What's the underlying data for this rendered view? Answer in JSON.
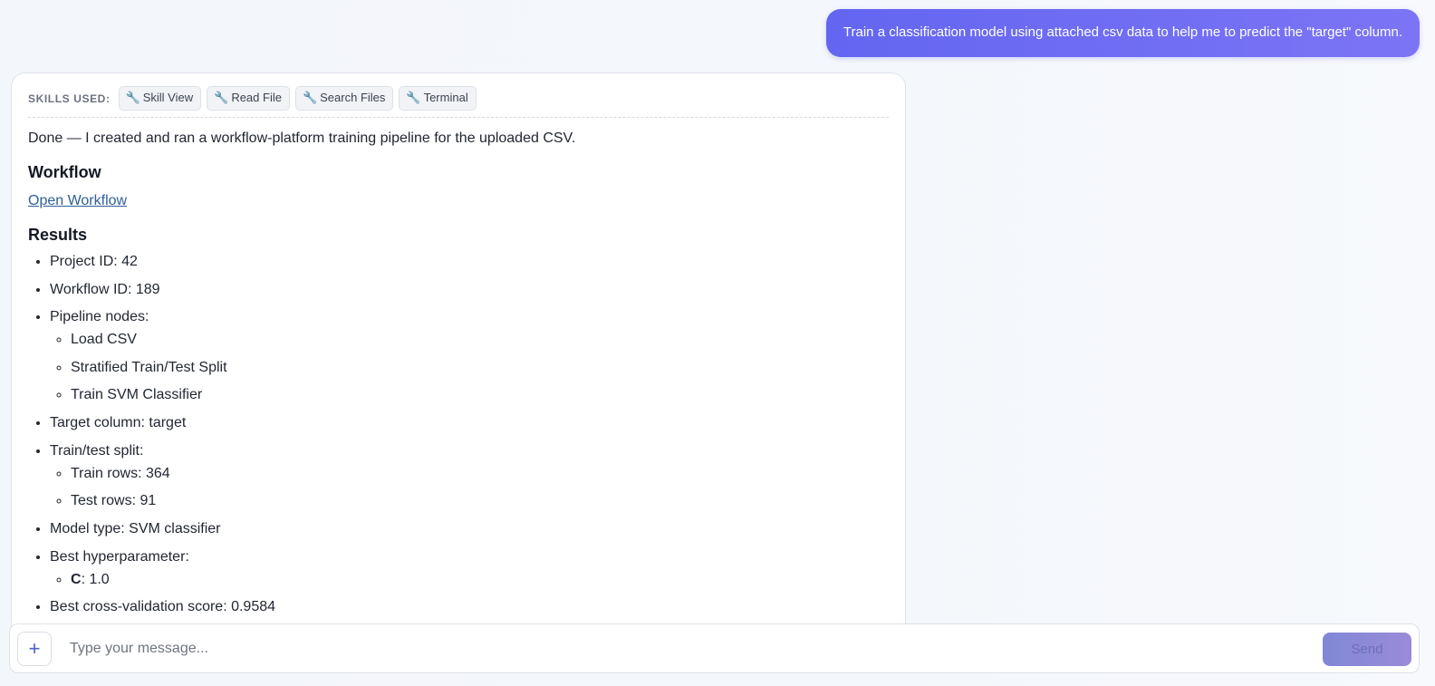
{
  "user_message": {
    "text": "Train a classification model using attached csv data to help me to predict the \"target\" column."
  },
  "assistant": {
    "skills_label": "SKILLS USED:",
    "skills": [
      {
        "icon": "wrench-icon",
        "glyph": "🔧",
        "label": "Skill View"
      },
      {
        "icon": "wrench-icon",
        "glyph": "🔧",
        "label": "Read File"
      },
      {
        "icon": "wrench-icon",
        "glyph": "🔧",
        "label": "Search Files"
      },
      {
        "icon": "wrench-icon",
        "glyph": "🔧",
        "label": "Terminal"
      }
    ],
    "intro": "Done — I created and ran a workflow-platform training pipeline for the uploaded CSV.",
    "workflow_heading": "Workflow",
    "workflow_link": "Open Workflow",
    "results_heading": "Results",
    "results": {
      "project_id": "Project ID: 42",
      "workflow_id": "Workflow ID: 189",
      "pipeline_label": "Pipeline nodes:",
      "pipeline_nodes": [
        "Load CSV",
        "Stratified Train/Test Split",
        "Train SVM Classifier"
      ],
      "target_column": "Target column: target",
      "split_label": "Train/test split:",
      "split": [
        "Train rows: 364",
        "Test rows: 91"
      ],
      "model_type": "Model type: SVM classifier",
      "hyper_label": "Best hyperparameter:",
      "hyper_name": "C",
      "hyper_value": ": 1.0",
      "cv_score": "Best cross-validation score: 0.9584"
    }
  },
  "composer": {
    "placeholder": "Type your message...",
    "send_label": "Send",
    "add_glyph": "+"
  }
}
